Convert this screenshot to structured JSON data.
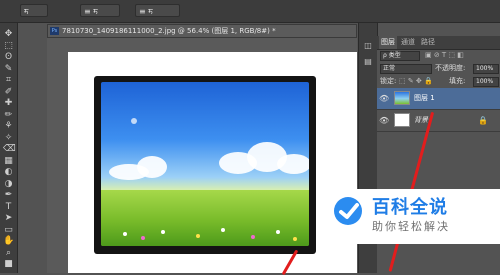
{
  "options_bar": {
    "menu_button": "ॸ",
    "align_button": "≡ ॸ",
    "distribute_button": "≡ ॸ"
  },
  "toolbox": {
    "tools": [
      "move-icon",
      "marquee-icon",
      "lasso-icon",
      "quick-select-icon",
      "crop-icon",
      "eyedropper-icon",
      "healing-icon",
      "brush-icon",
      "stamp-icon",
      "history-brush-icon",
      "eraser-icon",
      "gradient-icon",
      "blur-icon",
      "dodge-icon",
      "pen-icon",
      "type-icon",
      "path-select-icon",
      "shape-icon",
      "hand-icon",
      "zoom-icon",
      "color-swatch-icon"
    ]
  },
  "document": {
    "tab_badge": "Ps",
    "tab_title": "7810730_1409186111000_2.jpg @ 56.4% (图层 1, RGB/8#) *"
  },
  "layers_panel": {
    "tabs": [
      "图层",
      "通道",
      "路径"
    ],
    "filter_label": "ρ 类型",
    "blend_mode": "正常",
    "opacity_label": "不透明度:",
    "opacity_value": "100%",
    "lock_label": "锁定:",
    "fill_label": "填充:",
    "fill_value": "100%",
    "layers": [
      {
        "name": "图层 1",
        "selected": true
      },
      {
        "name": "背景",
        "selected": false
      }
    ]
  },
  "watermark": {
    "title": "百科全说",
    "subtitle": "助你轻松解决"
  },
  "colors": {
    "accent_red": "#e21d1d",
    "brand_blue": "#1f7de6",
    "selected_layer": "#4c6c98"
  }
}
